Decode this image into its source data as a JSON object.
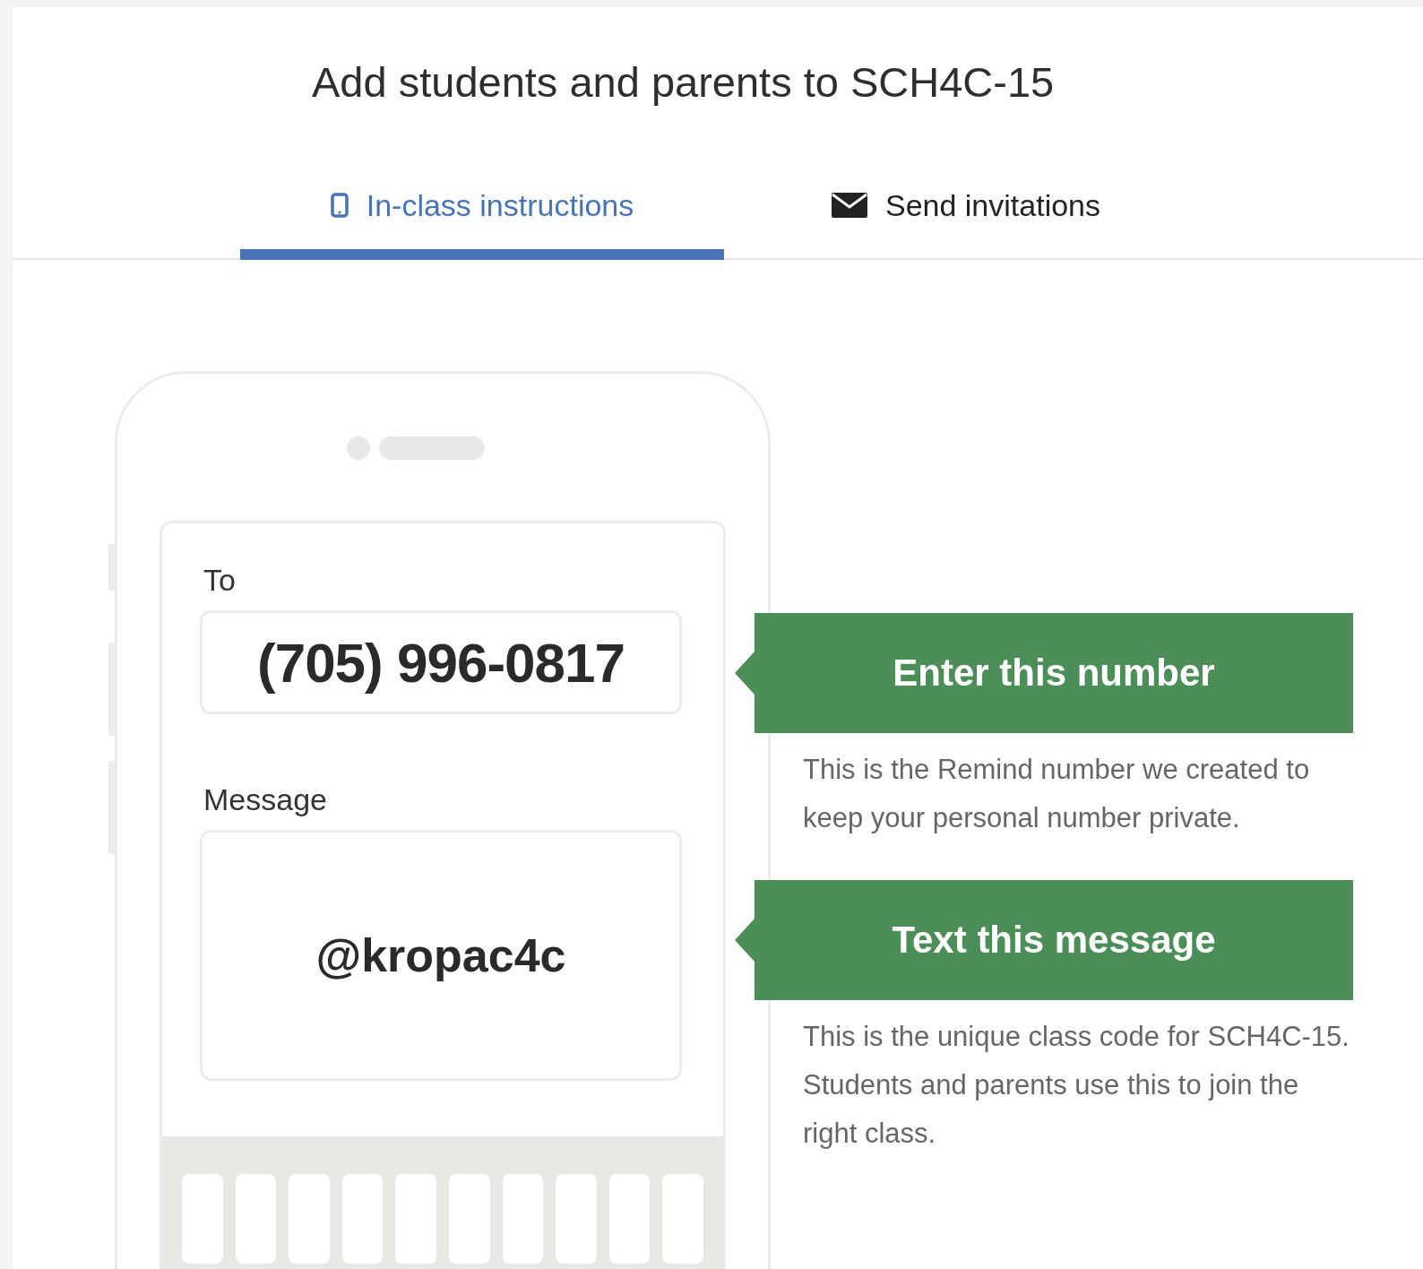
{
  "title": "Add students and parents to SCH4C-15",
  "tabs": [
    {
      "label": "In-class instructions",
      "selected": true
    },
    {
      "label": "Send invitations",
      "selected": false
    }
  ],
  "phone": {
    "to_label": "To",
    "to_value": "(705) 996-0817",
    "message_label": "Message",
    "message_value": "@kropac4c"
  },
  "steps": [
    {
      "heading": "Enter this number",
      "description": "This is the Remind number we created to keep your personal number private."
    },
    {
      "heading": "Text this message",
      "description": "This is the unique class code for SCH4C-15. Students and parents use this to join the right class."
    }
  ]
}
